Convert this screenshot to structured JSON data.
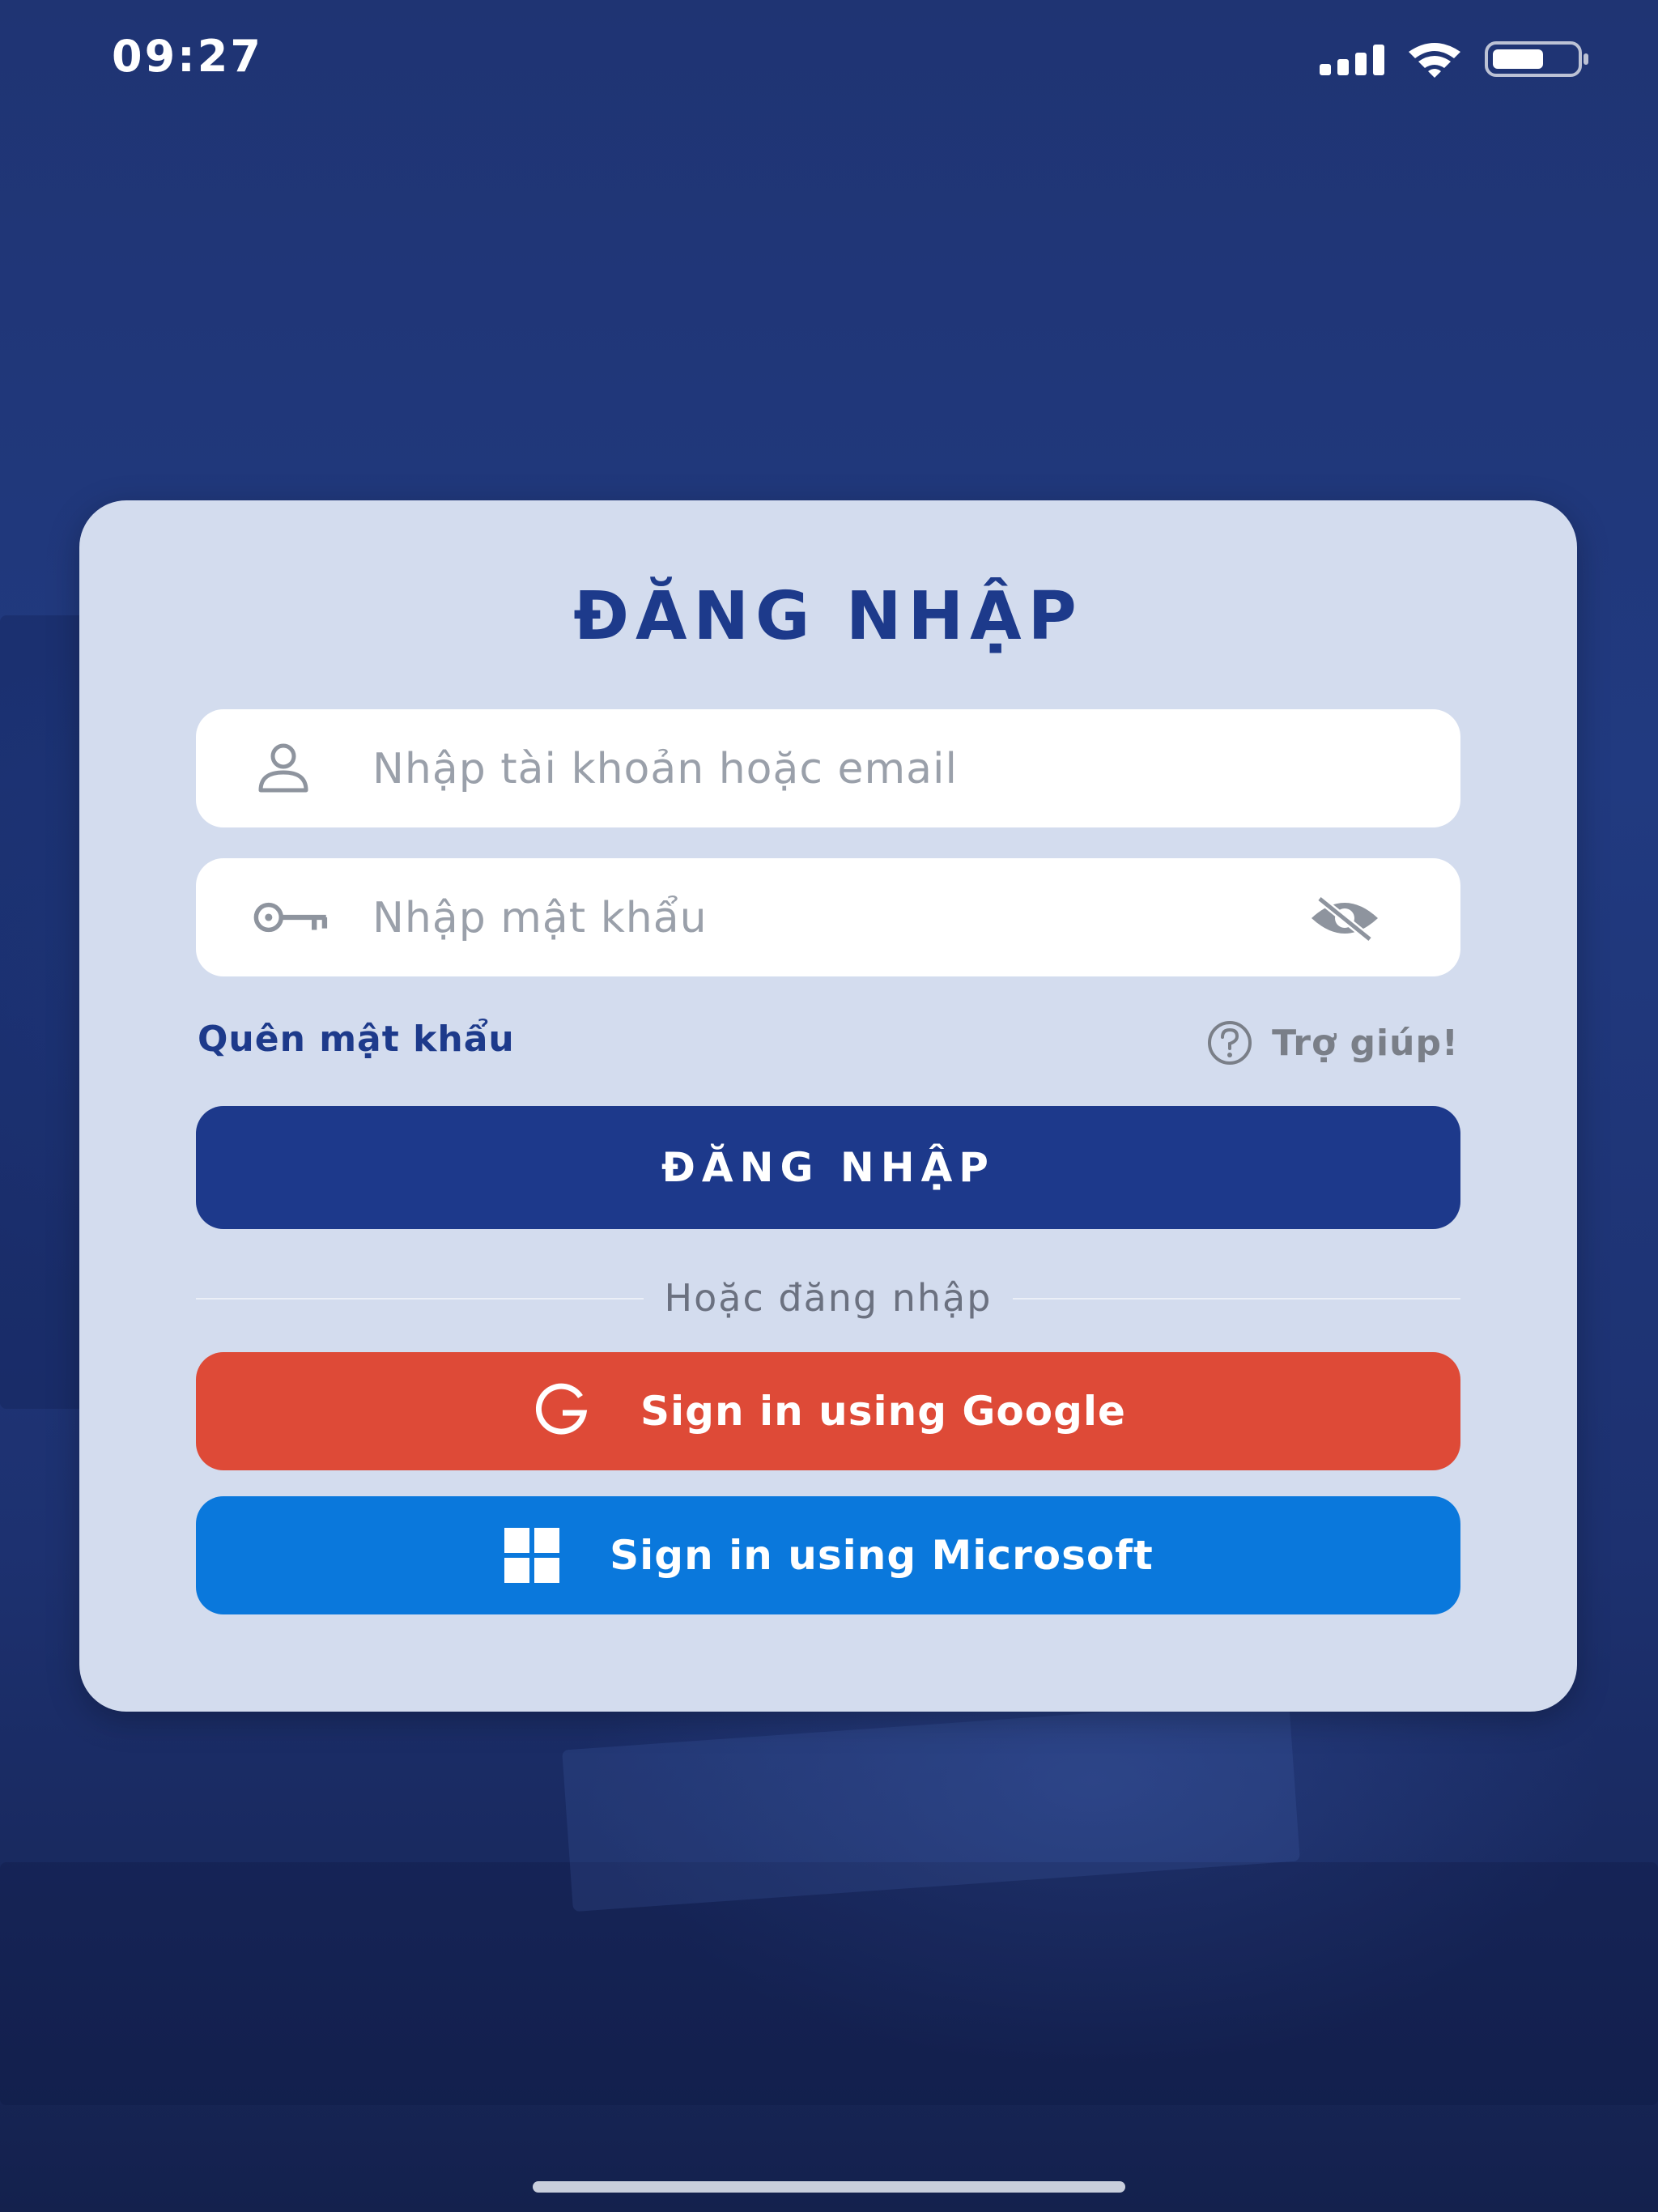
{
  "status_bar": {
    "time": "09:27"
  },
  "login": {
    "title": "ĐĂNG NHẬP",
    "username_placeholder": "Nhập tài khoản hoặc email",
    "password_placeholder": "Nhập mật khẩu",
    "forgot_password": "Quên mật khẩu",
    "help": "Trợ giúp!",
    "login_button": "ĐĂNG NHẬP",
    "divider_text": "Hoặc đăng nhập",
    "google_button": "Sign in using Google",
    "microsoft_button": "Sign in using Microsoft"
  },
  "icons": {
    "username": "person-icon",
    "password": "key-icon",
    "visibility": "eye-off-icon",
    "help": "question-circle-icon",
    "google": "google-icon",
    "microsoft": "windows-icon"
  },
  "colors": {
    "background": "#1f3372",
    "card": "#d3dcee",
    "primary": "#1d398b",
    "google": "#de4a37",
    "microsoft": "#0a78dc"
  }
}
